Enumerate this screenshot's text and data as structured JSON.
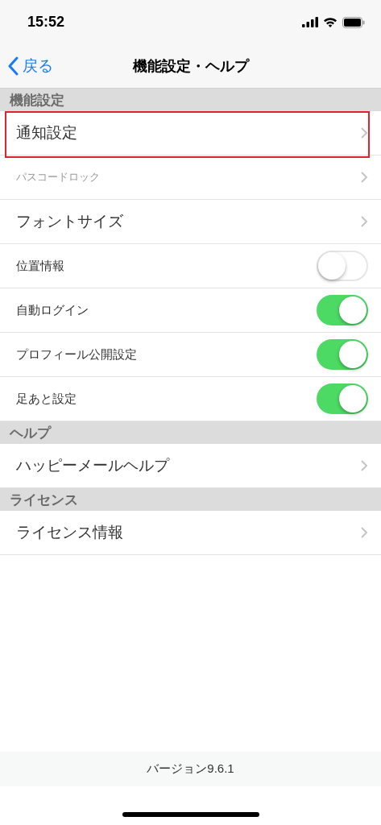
{
  "status_bar": {
    "time": "15:52"
  },
  "nav": {
    "back": "戻る",
    "title": "機能設定・ヘルプ"
  },
  "sections": [
    {
      "header": "機能設定",
      "rows": [
        {
          "kind": "link",
          "label": "通知設定",
          "disabled": false,
          "highlighted": true
        },
        {
          "kind": "link",
          "label": "パスコードロック",
          "disabled": true,
          "highlighted": false
        },
        {
          "kind": "link",
          "label": "フォントサイズ",
          "disabled": false,
          "highlighted": false
        },
        {
          "kind": "toggle",
          "label": "位置情報",
          "on": false
        },
        {
          "kind": "toggle",
          "label": "自動ログイン",
          "on": true
        },
        {
          "kind": "toggle",
          "label": "プロフィール公開設定",
          "on": true
        },
        {
          "kind": "toggle",
          "label": "足あと設定",
          "on": true
        }
      ]
    },
    {
      "header": "ヘルプ",
      "rows": [
        {
          "kind": "link",
          "label": "ハッピーメールヘルプ",
          "disabled": false,
          "highlighted": false
        }
      ]
    },
    {
      "header": "ライセンス",
      "rows": [
        {
          "kind": "link",
          "label": "ライセンス情報",
          "disabled": false,
          "highlighted": false
        }
      ]
    }
  ],
  "footer": {
    "version": "バージョン9.6.1"
  }
}
